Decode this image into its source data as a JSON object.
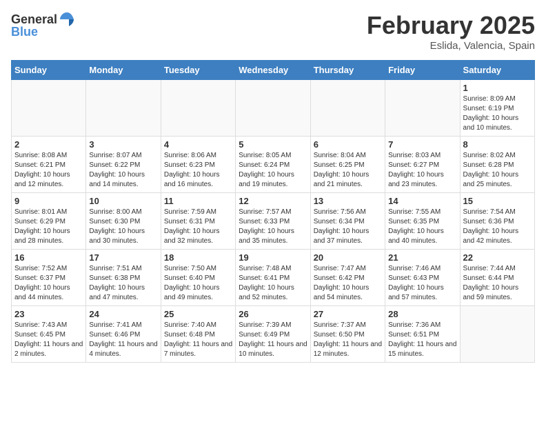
{
  "logo": {
    "general": "General",
    "blue": "Blue"
  },
  "header": {
    "month": "February 2025",
    "location": "Eslida, Valencia, Spain"
  },
  "weekdays": [
    "Sunday",
    "Monday",
    "Tuesday",
    "Wednesday",
    "Thursday",
    "Friday",
    "Saturday"
  ],
  "weeks": [
    [
      {
        "day": "",
        "info": ""
      },
      {
        "day": "",
        "info": ""
      },
      {
        "day": "",
        "info": ""
      },
      {
        "day": "",
        "info": ""
      },
      {
        "day": "",
        "info": ""
      },
      {
        "day": "",
        "info": ""
      },
      {
        "day": "1",
        "info": "Sunrise: 8:09 AM\nSunset: 6:19 PM\nDaylight: 10 hours and 10 minutes."
      }
    ],
    [
      {
        "day": "2",
        "info": "Sunrise: 8:08 AM\nSunset: 6:21 PM\nDaylight: 10 hours and 12 minutes."
      },
      {
        "day": "3",
        "info": "Sunrise: 8:07 AM\nSunset: 6:22 PM\nDaylight: 10 hours and 14 minutes."
      },
      {
        "day": "4",
        "info": "Sunrise: 8:06 AM\nSunset: 6:23 PM\nDaylight: 10 hours and 16 minutes."
      },
      {
        "day": "5",
        "info": "Sunrise: 8:05 AM\nSunset: 6:24 PM\nDaylight: 10 hours and 19 minutes."
      },
      {
        "day": "6",
        "info": "Sunrise: 8:04 AM\nSunset: 6:25 PM\nDaylight: 10 hours and 21 minutes."
      },
      {
        "day": "7",
        "info": "Sunrise: 8:03 AM\nSunset: 6:27 PM\nDaylight: 10 hours and 23 minutes."
      },
      {
        "day": "8",
        "info": "Sunrise: 8:02 AM\nSunset: 6:28 PM\nDaylight: 10 hours and 25 minutes."
      }
    ],
    [
      {
        "day": "9",
        "info": "Sunrise: 8:01 AM\nSunset: 6:29 PM\nDaylight: 10 hours and 28 minutes."
      },
      {
        "day": "10",
        "info": "Sunrise: 8:00 AM\nSunset: 6:30 PM\nDaylight: 10 hours and 30 minutes."
      },
      {
        "day": "11",
        "info": "Sunrise: 7:59 AM\nSunset: 6:31 PM\nDaylight: 10 hours and 32 minutes."
      },
      {
        "day": "12",
        "info": "Sunrise: 7:57 AM\nSunset: 6:33 PM\nDaylight: 10 hours and 35 minutes."
      },
      {
        "day": "13",
        "info": "Sunrise: 7:56 AM\nSunset: 6:34 PM\nDaylight: 10 hours and 37 minutes."
      },
      {
        "day": "14",
        "info": "Sunrise: 7:55 AM\nSunset: 6:35 PM\nDaylight: 10 hours and 40 minutes."
      },
      {
        "day": "15",
        "info": "Sunrise: 7:54 AM\nSunset: 6:36 PM\nDaylight: 10 hours and 42 minutes."
      }
    ],
    [
      {
        "day": "16",
        "info": "Sunrise: 7:52 AM\nSunset: 6:37 PM\nDaylight: 10 hours and 44 minutes."
      },
      {
        "day": "17",
        "info": "Sunrise: 7:51 AM\nSunset: 6:38 PM\nDaylight: 10 hours and 47 minutes."
      },
      {
        "day": "18",
        "info": "Sunrise: 7:50 AM\nSunset: 6:40 PM\nDaylight: 10 hours and 49 minutes."
      },
      {
        "day": "19",
        "info": "Sunrise: 7:48 AM\nSunset: 6:41 PM\nDaylight: 10 hours and 52 minutes."
      },
      {
        "day": "20",
        "info": "Sunrise: 7:47 AM\nSunset: 6:42 PM\nDaylight: 10 hours and 54 minutes."
      },
      {
        "day": "21",
        "info": "Sunrise: 7:46 AM\nSunset: 6:43 PM\nDaylight: 10 hours and 57 minutes."
      },
      {
        "day": "22",
        "info": "Sunrise: 7:44 AM\nSunset: 6:44 PM\nDaylight: 10 hours and 59 minutes."
      }
    ],
    [
      {
        "day": "23",
        "info": "Sunrise: 7:43 AM\nSunset: 6:45 PM\nDaylight: 11 hours and 2 minutes."
      },
      {
        "day": "24",
        "info": "Sunrise: 7:41 AM\nSunset: 6:46 PM\nDaylight: 11 hours and 4 minutes."
      },
      {
        "day": "25",
        "info": "Sunrise: 7:40 AM\nSunset: 6:48 PM\nDaylight: 11 hours and 7 minutes."
      },
      {
        "day": "26",
        "info": "Sunrise: 7:39 AM\nSunset: 6:49 PM\nDaylight: 11 hours and 10 minutes."
      },
      {
        "day": "27",
        "info": "Sunrise: 7:37 AM\nSunset: 6:50 PM\nDaylight: 11 hours and 12 minutes."
      },
      {
        "day": "28",
        "info": "Sunrise: 7:36 AM\nSunset: 6:51 PM\nDaylight: 11 hours and 15 minutes."
      },
      {
        "day": "",
        "info": ""
      }
    ]
  ]
}
